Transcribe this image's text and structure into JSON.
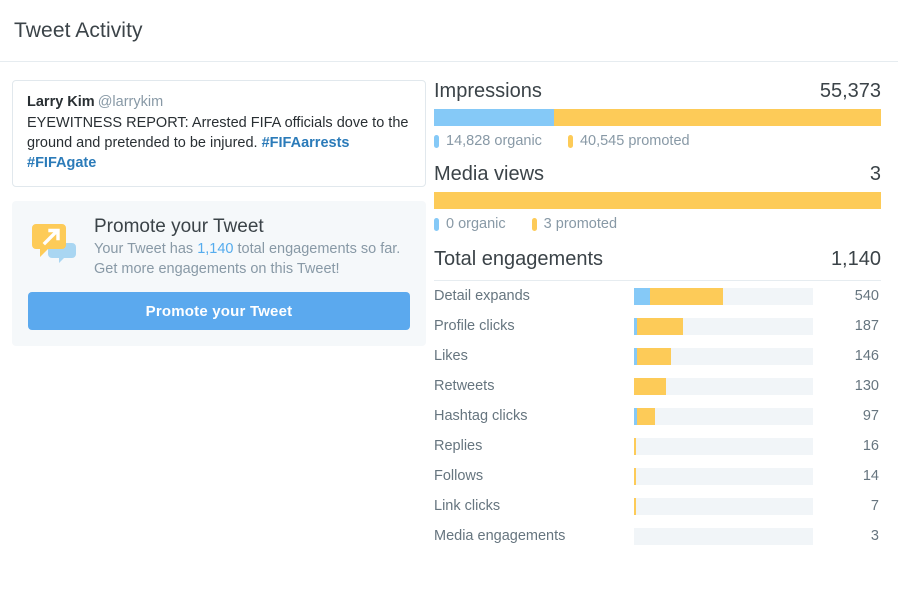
{
  "header": {
    "title": "Tweet Activity"
  },
  "tweet": {
    "name": "Larry Kim",
    "handle": "@larrykim",
    "text_before": "EYEWITNESS REPORT: Arrested FIFA officials dove to the ground and pretended to be injured. ",
    "hashtag_1": "#FIFAarrests",
    "hashtag_2": "#FIFAgate"
  },
  "promote": {
    "icon": "promote-megaphone-icon",
    "heading": "Promote your Tweet",
    "sub_prefix": "Your Tweet has ",
    "sub_highlight": "1,140",
    "sub_suffix": " total engagements so far.",
    "sub_line2": "Get more engagements on this Tweet!",
    "button_label": "Promote your Tweet"
  },
  "colors": {
    "organic": "#85c9f7",
    "promoted": "#fdcb58",
    "track": "#f1f5f8",
    "link": "#2b7bb9",
    "button": "#5ba9ee"
  },
  "chart_data": [
    {
      "type": "bar",
      "title": "Impressions",
      "total": "55,373",
      "total_value": 55373,
      "orientation": "horizontal-stacked",
      "series": [
        {
          "name": "organic",
          "value": 14828,
          "label": "14,828 organic",
          "color": "#85c9f7"
        },
        {
          "name": "promoted",
          "value": 40545,
          "label": "40,545 promoted",
          "color": "#fdcb58"
        }
      ],
      "legend_position": "bottom"
    },
    {
      "type": "bar",
      "title": "Media views",
      "total": "3",
      "total_value": 3,
      "orientation": "horizontal-stacked",
      "series": [
        {
          "name": "organic",
          "value": 0,
          "label": "0 organic",
          "color": "#85c9f7"
        },
        {
          "name": "promoted",
          "value": 3,
          "label": "3 promoted",
          "color": "#fdcb58"
        }
      ],
      "legend_position": "bottom"
    },
    {
      "type": "bar",
      "title": "Total engagements",
      "total": "1,140",
      "total_value": 1140,
      "orientation": "horizontal-stacked-rows",
      "xlabel": "",
      "ylabel": "",
      "xlim": [
        0,
        700
      ],
      "grid": false,
      "categories": [
        "Detail expands",
        "Profile clicks",
        "Likes",
        "Retweets",
        "Hashtag clicks",
        "Replies",
        "Follows",
        "Link clicks",
        "Media engagements"
      ],
      "values": [
        540,
        187,
        146,
        130,
        97,
        16,
        14,
        7,
        3
      ],
      "value_labels": [
        "540",
        "187",
        "146",
        "130",
        "97",
        "16",
        "14",
        "7",
        "3"
      ],
      "rows": [
        {
          "label": "Detail expands",
          "count": "540",
          "organic_pct": 9,
          "promoted_pct": 41
        },
        {
          "label": "Profile clicks",
          "count": "187",
          "organic_pct": 1.5,
          "promoted_pct": 26
        },
        {
          "label": "Likes",
          "count": "146",
          "organic_pct": 1.5,
          "promoted_pct": 19
        },
        {
          "label": "Retweets",
          "count": "130",
          "organic_pct": 0,
          "promoted_pct": 18
        },
        {
          "label": "Hashtag clicks",
          "count": "97",
          "organic_pct": 1.5,
          "promoted_pct": 10
        },
        {
          "label": "Replies",
          "count": "16",
          "organic_pct": 0,
          "promoted_pct": 1.1
        },
        {
          "label": "Follows",
          "count": "14",
          "organic_pct": 0,
          "promoted_pct": 1.1
        },
        {
          "label": "Link clicks",
          "count": "7",
          "organic_pct": 0,
          "promoted_pct": 1.1
        },
        {
          "label": "Media engagements",
          "count": "3",
          "organic_pct": 0,
          "promoted_pct": 0
        }
      ]
    }
  ]
}
